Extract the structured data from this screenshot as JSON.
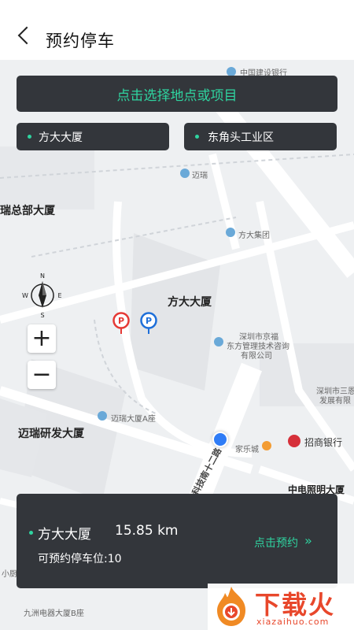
{
  "header": {
    "title": "预约停车"
  },
  "search": {
    "prompt": "点击选择地点或项目"
  },
  "chips": {
    "left": "方大大厦",
    "right": "东角头工业区"
  },
  "map": {
    "labels": {
      "ccb": "中国建设银行",
      "ruijie": "瑞总部大厦",
      "mairui": "迈瑞",
      "fangda_group": "方大集团",
      "fangda_building": "方大大厦",
      "consult": "深圳市京福",
      "consult2": "东方管理技术咨询",
      "consult3": "有限公司",
      "sanen": "深圳市三恩",
      "sanen2": "发展有限",
      "mairui_a": "迈瑞大厦A座",
      "mairui_rd": "迈瑞研发大厦",
      "jialecheng": "家乐城",
      "cmb": "招商银行",
      "cec": "中电照明大厦",
      "road": "科技南十二路",
      "jiuzhou": "九洲电器大厦B座",
      "xiaoshe": "小厨"
    },
    "compass": {
      "n": "N",
      "s": "S",
      "e": "E",
      "w": "W"
    },
    "zoom_in": "+",
    "zoom_out": "−",
    "pin_label": "P"
  },
  "card": {
    "name": "方大大厦",
    "distance": "15.85 km",
    "slots": "可预约停车位:10",
    "book": "点击预约",
    "book_chevron": "»"
  },
  "watermark": {
    "text": "下载火",
    "url": "xiazaihuo.com"
  },
  "colors": {
    "accent": "#2fd4a0",
    "dark": "#33363b",
    "pin_red": "#e53935",
    "pin_blue": "#1e6fd9"
  }
}
